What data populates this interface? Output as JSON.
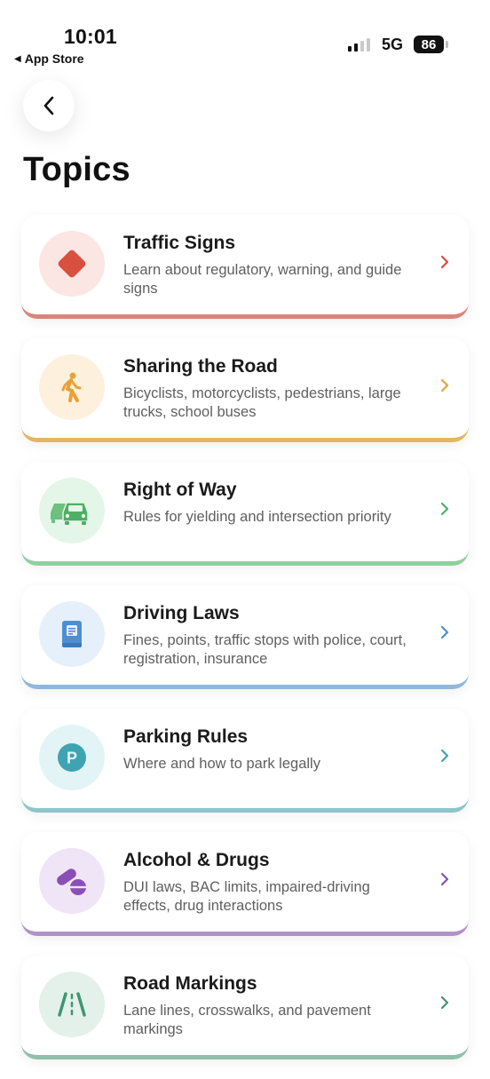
{
  "status_bar": {
    "time": "10:01",
    "back_label": "App Store",
    "network": "5G",
    "battery": "86"
  },
  "page": {
    "title": "Topics"
  },
  "topics": [
    {
      "title": "Traffic Signs",
      "desc": "Learn about regulatory, warning, and guide signs",
      "icon": "diamond-sign-icon",
      "accent": "#d9857a",
      "tint": "#fbe6e3"
    },
    {
      "title": "Sharing the Road",
      "desc": "Bicyclists, motorcyclists, pedestrians, large trucks, school buses",
      "icon": "pedestrian-icon",
      "accent": "#e2b763",
      "tint": "#fdf1de"
    },
    {
      "title": "Right of Way",
      "desc": "Rules for yielding and intersection priority",
      "icon": "cars-icon",
      "accent": "#8fd09f",
      "tint": "#e4f6e8"
    },
    {
      "title": "Driving Laws",
      "desc": "Fines, points, traffic stops with police, court, registration, insurance",
      "icon": "law-book-icon",
      "accent": "#92b7dc",
      "tint": "#e6f0fb"
    },
    {
      "title": "Parking Rules",
      "desc": "Where and how to park legally",
      "icon": "parking-icon",
      "accent": "#8ec4cc",
      "tint": "#e3f4f6"
    },
    {
      "title": "Alcohol & Drugs",
      "desc": "DUI laws, BAC limits, impaired-driving effects, drug interactions",
      "icon": "pills-icon",
      "accent": "#b093c9",
      "tint": "#efe5f7"
    },
    {
      "title": "Road Markings",
      "desc": "Lane lines, crosswalks, and pavement markings",
      "icon": "road-icon",
      "accent": "#8fbfaa",
      "tint": "#e3f1ea"
    }
  ]
}
